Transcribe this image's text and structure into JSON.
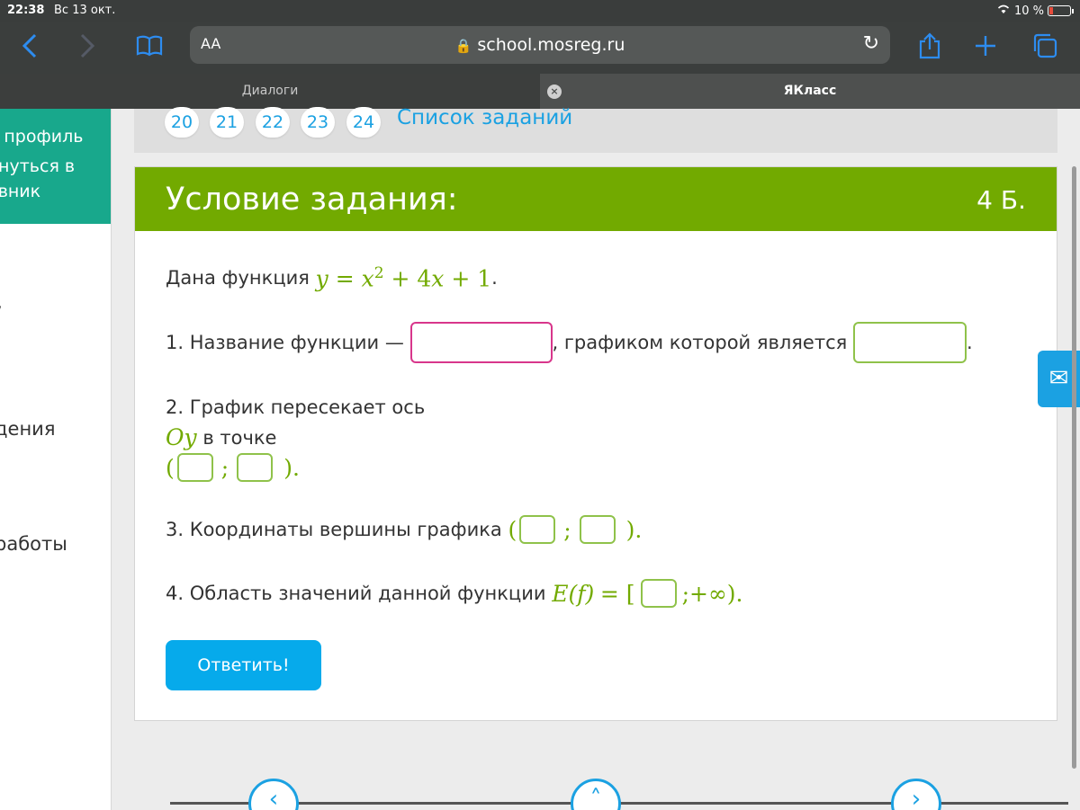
{
  "status": {
    "time": "22:38",
    "date": "Вс 13 окт.",
    "battery": "10 %"
  },
  "browser": {
    "text_size": "AA",
    "url": "school.mosreg.ru",
    "tabs": [
      {
        "label": "Диалоги"
      },
      {
        "label": "ЯКласс"
      }
    ]
  },
  "sidebar": {
    "profile_lines": [
      "й профиль",
      "рнуться в",
      "евник"
    ],
    "items": [
      "/",
      "дения",
      "работы"
    ]
  },
  "task_nav": {
    "numbers": [
      "20",
      "21",
      "22",
      "23",
      "24"
    ],
    "list_label": "Список заданий"
  },
  "card": {
    "title": "Условие задания:",
    "points": "4 Б.",
    "intro": "Дана функция",
    "formula": {
      "y": "y",
      "eq": "=",
      "x": "x",
      "exp": "2",
      "rest": "+ 4",
      "x2": "x",
      "tail": "+ 1",
      "dot": "."
    },
    "q1": {
      "text1": "1. Название функции —",
      "text2": ", графиком которой является",
      "end": "."
    },
    "q2": {
      "text1": "2. График пересекает ось",
      "axis": "Oy",
      "text2": "в точке",
      "open": "(",
      "sep": ";",
      "close": ")."
    },
    "q3": {
      "text": "3. Координаты вершины графика",
      "open": "(",
      "sep": ";",
      "close": ")."
    },
    "q4": {
      "text": "4. Область значений данной функции",
      "func": "E(f)",
      "eq": "= [",
      "sep": ";",
      "inf": "+∞",
      "close": ")."
    },
    "answer_label": "Ответить!"
  },
  "colors": {
    "header_green": "#72aa00",
    "link_blue": "#1ba1e2",
    "button_blue": "#06aaeb",
    "sidebar_teal": "#18a88c"
  }
}
